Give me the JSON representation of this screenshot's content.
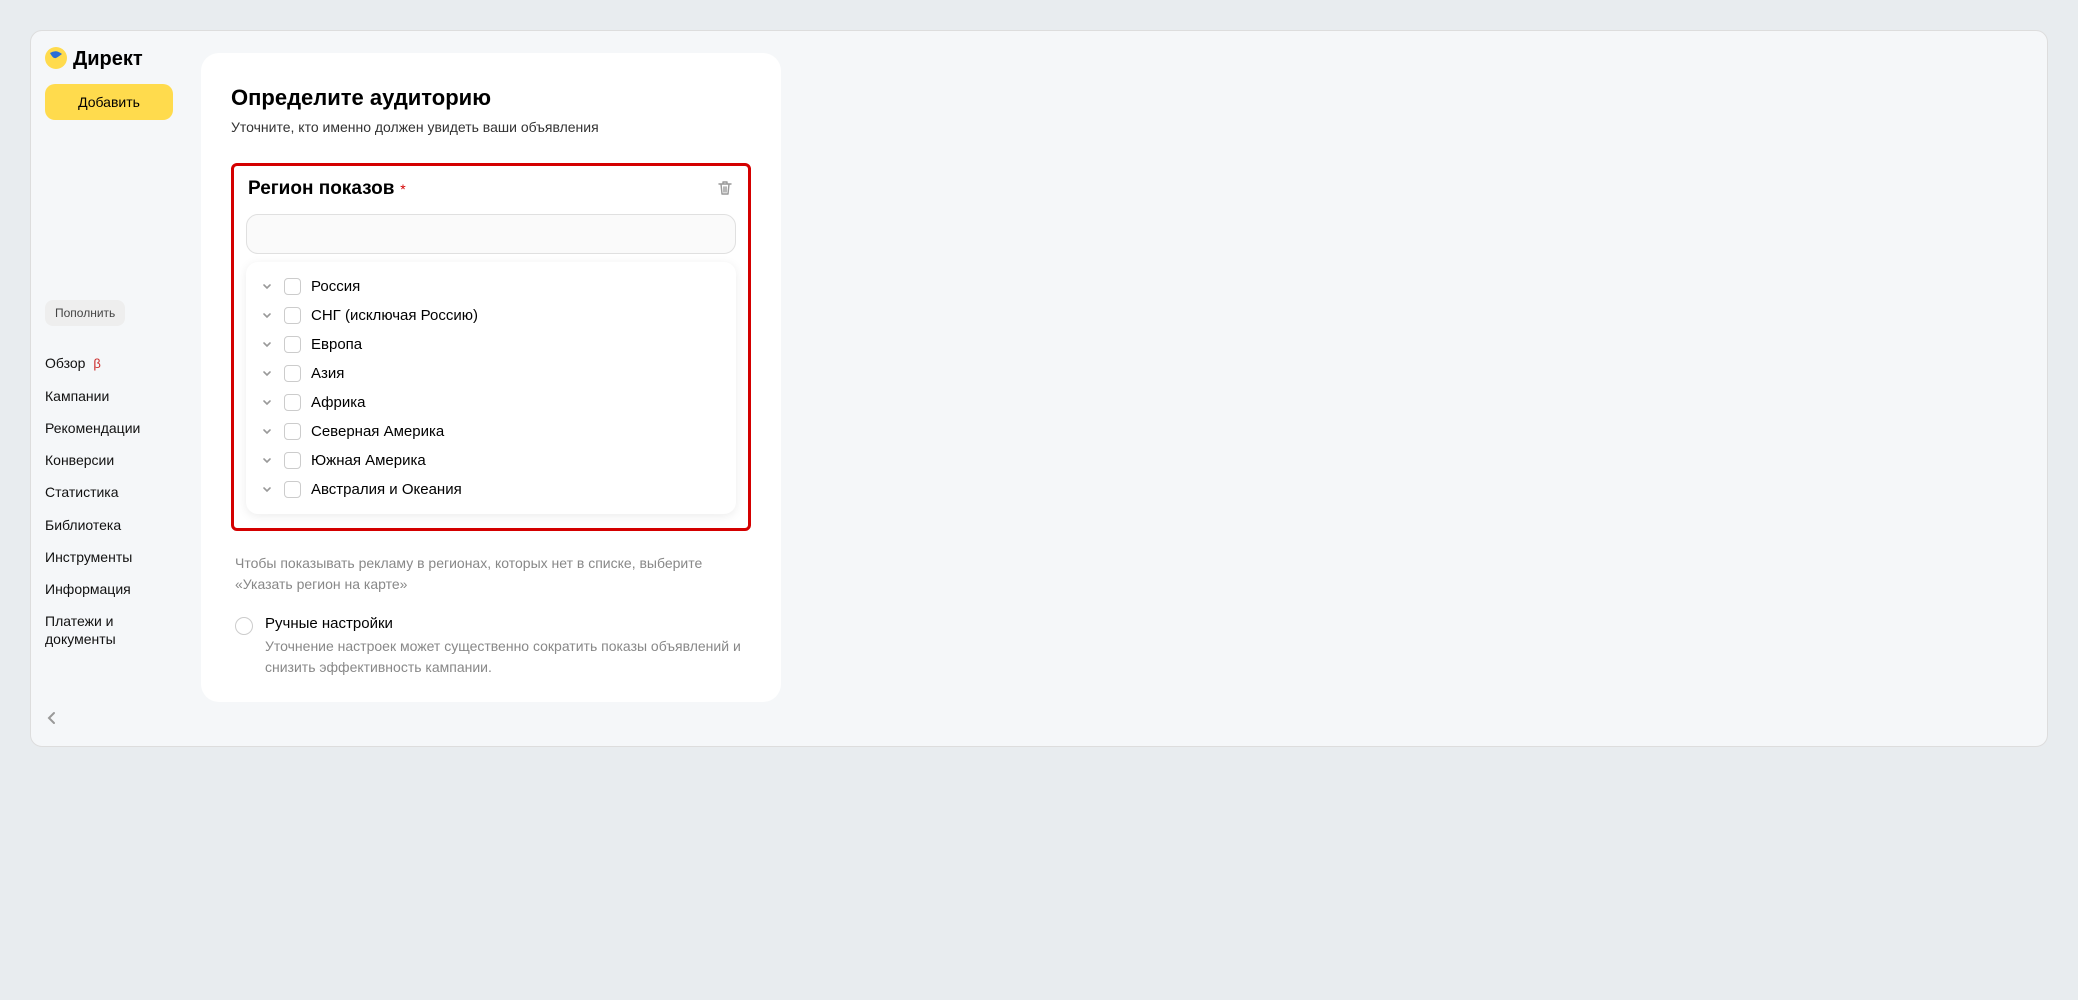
{
  "brand": {
    "name": "Директ"
  },
  "sidebar": {
    "add_button": "Добавить",
    "topup_button": "Пополнить",
    "nav": [
      {
        "label": "Обзор",
        "beta": "β"
      },
      {
        "label": "Кампании",
        "beta": ""
      },
      {
        "label": "Рекомендации",
        "beta": ""
      },
      {
        "label": "Конверсии",
        "beta": ""
      },
      {
        "label": "Статистика",
        "beta": ""
      },
      {
        "label": "Библиотека",
        "beta": ""
      },
      {
        "label": "Инструменты",
        "beta": ""
      },
      {
        "label": "Информация",
        "beta": ""
      },
      {
        "label": "Платежи и документы",
        "beta": ""
      }
    ]
  },
  "main": {
    "title": "Определите аудиторию",
    "subtitle": "Уточните, кто именно должен увидеть ваши объявления",
    "region": {
      "title": "Регион показов",
      "required_mark": "*",
      "input_value": "",
      "options": [
        {
          "label": "Россия"
        },
        {
          "label": "СНГ (исключая Россию)"
        },
        {
          "label": "Европа"
        },
        {
          "label": "Азия"
        },
        {
          "label": "Африка"
        },
        {
          "label": "Северная Америка"
        },
        {
          "label": "Южная Америка"
        },
        {
          "label": "Австралия и Океания"
        }
      ]
    },
    "hint": "Чтобы показывать рекламу в регионах, которых нет в списке, выберите «Указать регион на карте»",
    "manual": {
      "title": "Ручные настройки",
      "desc": "Уточнение настроек может существенно сократить показы объявлений и снизить эффективность кампании."
    }
  },
  "colors": {
    "accent_yellow": "#ffdb4d",
    "highlight_red": "#d40000"
  }
}
